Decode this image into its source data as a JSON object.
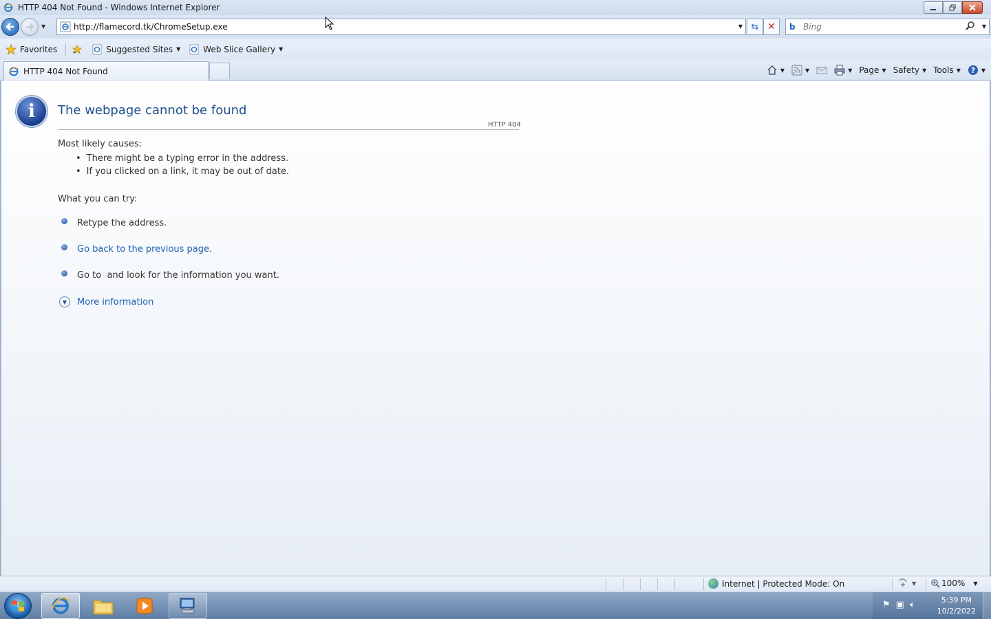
{
  "window": {
    "title": "HTTP 404 Not Found - Windows Internet Explorer",
    "controls": [
      "minimize",
      "restore",
      "close"
    ]
  },
  "address_bar": {
    "url": "http://flamecord.tk/ChromeSetup.exe",
    "search_placeholder": "Bing"
  },
  "favorites_bar": {
    "favorites_label": "Favorites",
    "items": [
      {
        "label": "Suggested Sites"
      },
      {
        "label": "Web Slice Gallery"
      }
    ]
  },
  "tabs": [
    {
      "label": "HTTP 404 Not Found",
      "active": true
    }
  ],
  "command_bar": {
    "page_label": "Page",
    "safety_label": "Safety",
    "tools_label": "Tools"
  },
  "error_page": {
    "title": "The webpage cannot be found",
    "code": "HTTP 404",
    "causes_heading": "Most likely causes:",
    "causes": [
      "There might be a typing error in the address.",
      "If you clicked on a link, it may be out of date."
    ],
    "try_heading": "What you can try:",
    "try_items": [
      {
        "text": "Retype the address.",
        "is_link": false
      },
      {
        "text": "Go back to the previous page.",
        "is_link": true
      },
      {
        "text": "Go to  and look for the information you want.",
        "is_link": false
      }
    ],
    "more_info": "More information"
  },
  "status_bar": {
    "zone": "Internet | Protected Mode: On",
    "zoom": "100%"
  },
  "taskbar": {
    "time": "5:39 PM",
    "date": "10/2/2022"
  },
  "colors": {
    "title_blue": "#1f4f8b",
    "link_blue": "#1f63b5",
    "taskbar": "#6f8db3"
  }
}
